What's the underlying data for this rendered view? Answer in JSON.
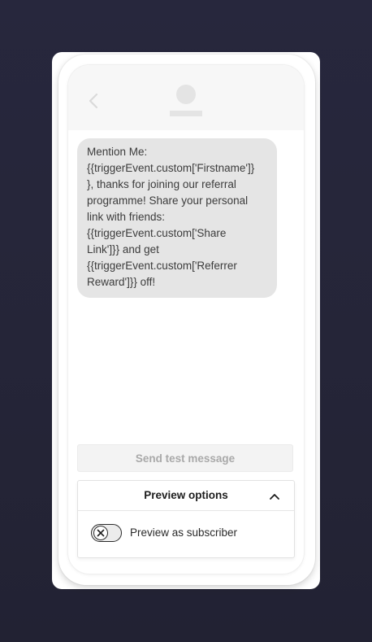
{
  "message": {
    "text": "Mention Me:\n{{triggerEvent.custom['Firstname']}\n}, thanks for joining our referral\nprogramme! Share your personal\nlink with friends:\n{{triggerEvent.custom['Share\nLink']}} and get\n{{triggerEvent.custom['Referrer\nReward']}} off!"
  },
  "actions": {
    "send_test_label": "Send test message"
  },
  "preview_options": {
    "title": "Preview options",
    "expanded": true,
    "subscriber_toggle": {
      "label": "Preview as subscriber",
      "enabled": false
    }
  },
  "icons": {
    "back": "chevron-left-icon",
    "avatar": "contact-avatar-icon",
    "collapse": "chevron-up-icon",
    "toggle_off": "close-icon"
  },
  "colors": {
    "background": "#252538",
    "bubble": "#e5e5e5",
    "header": "#f7f7f7"
  }
}
